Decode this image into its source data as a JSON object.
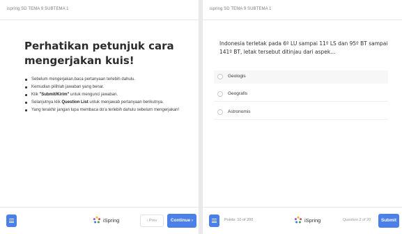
{
  "colors": {
    "accent": "#4b80e8",
    "text": "#303030",
    "muted": "#8a8a8a",
    "background": "#f3f3f5",
    "panel": "#ffffff"
  },
  "left": {
    "header": "ispring SD TEMA 9 SUBTEMA 1",
    "title": "Perhatikan petunjuk cara mengerjakan kuis!",
    "steps": [
      {
        "text": "Sebelum mengerjakan,baca pertanyaan terlebih dahulu."
      },
      {
        "text": "Kemudian pilihlah jawaban yang benar."
      },
      {
        "pre": "Klik ",
        "bold": "\"Submit/Kirim\"",
        "post": " untuk mengunci jawaban."
      },
      {
        "pre": "Selanjutnya klik ",
        "bold": "Question List",
        "post": " untuk menjawab pertanyaan berikutnya."
      },
      {
        "text": "Yang terakhir  jangan lupa membaca do'a terlebih dahulu sebelum mengerjakan!"
      }
    ],
    "footer": {
      "menu_icon": "hamburger-menu-icon",
      "brand_icon": "ispring-logo-icon",
      "brand": "iSpring",
      "prev_label": "‹  Prev",
      "continue_label": "Continue  ›"
    }
  },
  "right": {
    "header": "ispring SD TEMA 9 SUBTEMA 1",
    "question": "Indonesia terletak pada 6º LU sampai 11º LS dan 95º BT sampai 141º BT, letak tersebut ditinjau dari aspek...",
    "options": [
      "Geologis",
      "Geografis",
      "Astronomis"
    ],
    "footer": {
      "menu_icon": "hamburger-menu-icon",
      "points": "Points: 10 of 200",
      "brand_icon": "ispring-logo-icon",
      "brand": "iSpring",
      "question_counter": "Question 2 of 20",
      "submit_label": "Submit"
    }
  }
}
